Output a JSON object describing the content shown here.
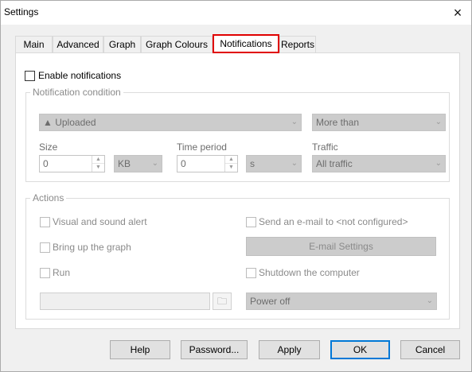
{
  "window": {
    "title": "Settings",
    "close_icon": "×"
  },
  "tabs": [
    {
      "label": "Main"
    },
    {
      "label": "Advanced"
    },
    {
      "label": "Graph"
    },
    {
      "label": "Graph Colours"
    },
    {
      "label": "Notifications",
      "active": true
    },
    {
      "label": "Reports"
    }
  ],
  "notifications": {
    "enable_label": "Enable notifications",
    "enable_checked": false,
    "condition": {
      "legend": "Notification condition",
      "direction": "▲ Uploaded",
      "comparison": "More than",
      "size_label": "Size",
      "size_value": "0",
      "size_unit": "KB",
      "time_label": "Time period",
      "time_value": "0",
      "time_unit": "s",
      "traffic_label": "Traffic",
      "traffic_value": "All traffic"
    },
    "actions": {
      "legend": "Actions",
      "visual_alert": "Visual and sound alert",
      "bring_up_graph": "Bring up the graph",
      "run": "Run",
      "send_email": "Send an e-mail to <not configured>",
      "email_settings": "E-mail Settings",
      "shutdown": "Shutdown the computer",
      "power_option": "Power off",
      "run_path": ""
    }
  },
  "footer": {
    "help": "Help",
    "password": "Password...",
    "apply": "Apply",
    "ok": "OK",
    "cancel": "Cancel"
  },
  "icons": {
    "dropdown": "⌄",
    "spin_up": "▲",
    "spin_down": "▼",
    "folder": "🗀"
  },
  "colors": {
    "active_tab_highlight": "#e00000",
    "default_button_border": "#0078d7"
  }
}
